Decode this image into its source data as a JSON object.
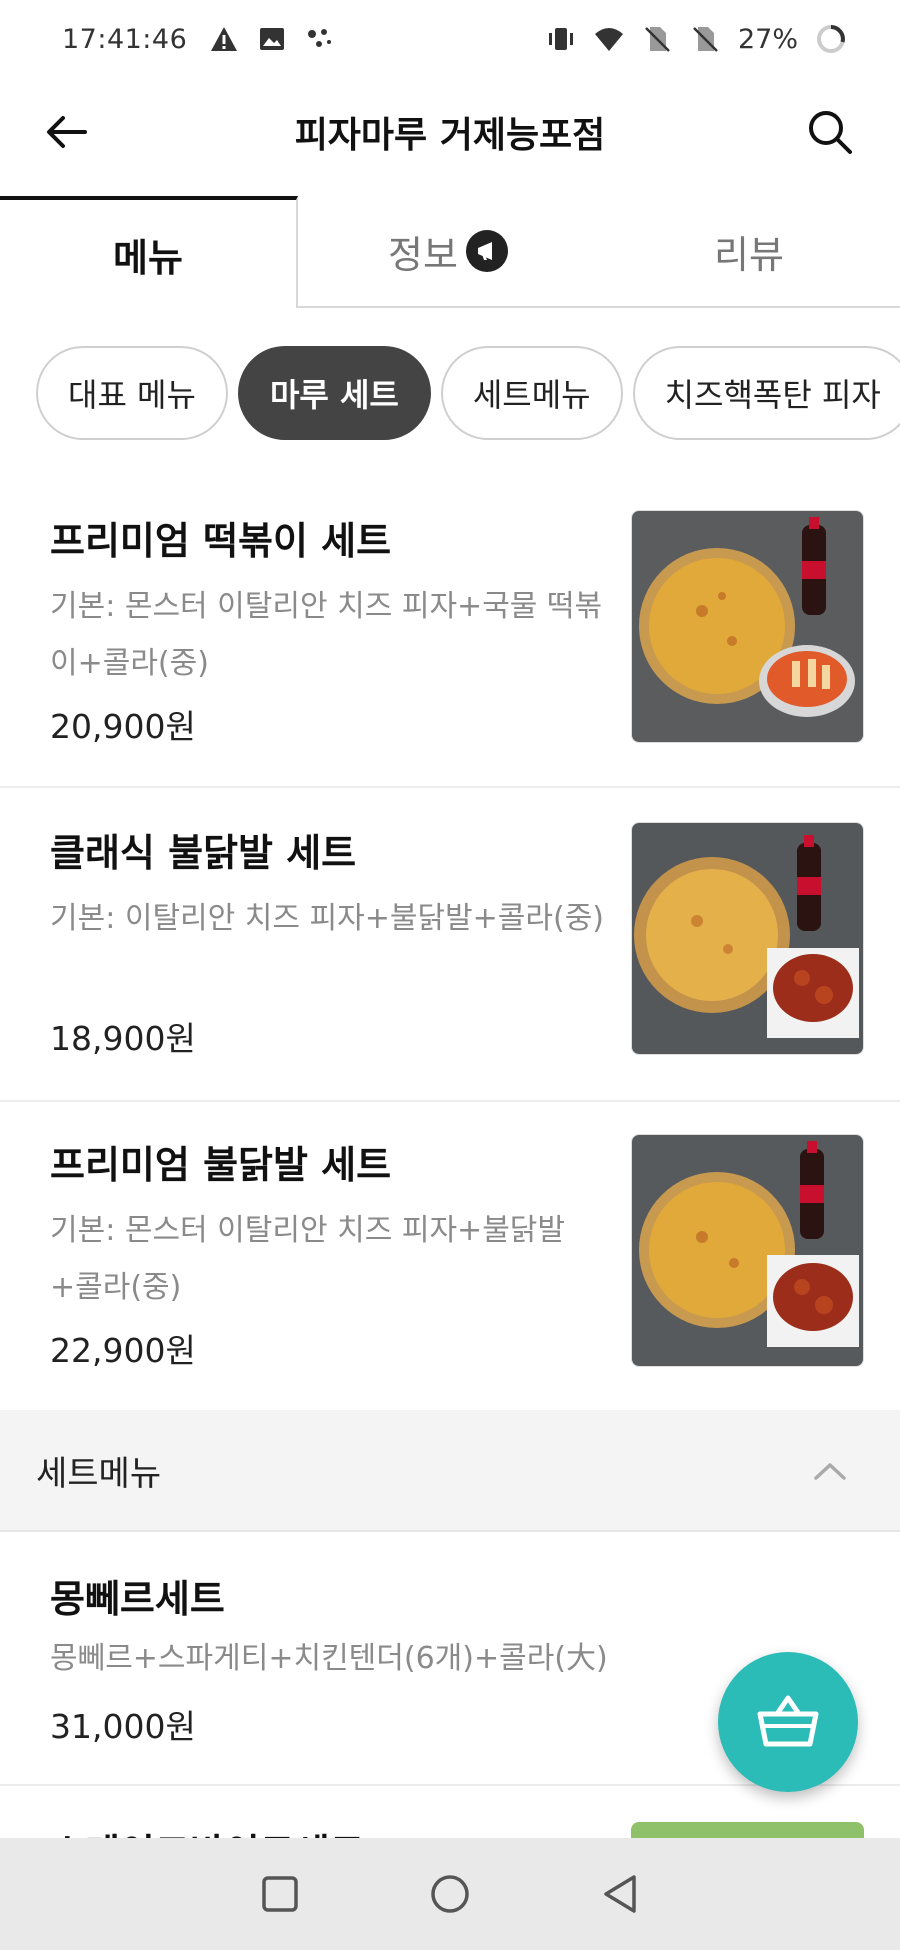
{
  "status_bar": {
    "time": "17:41:46",
    "battery": "27%"
  },
  "header": {
    "title": "피자마루 거제능포점"
  },
  "tabs": [
    {
      "label": "메뉴",
      "active": true
    },
    {
      "label": "정보",
      "active": false
    },
    {
      "label": "리뷰",
      "active": false
    }
  ],
  "chips": [
    {
      "label": "대표 메뉴",
      "active": false
    },
    {
      "label": "마루 세트",
      "active": true
    },
    {
      "label": "세트메뉴",
      "active": false
    },
    {
      "label": "치즈핵폭탄 피자",
      "active": false
    }
  ],
  "menu_items": [
    {
      "name": "프리미엄 떡볶이 세트",
      "desc": "기본: 몬스터 이탈리안 치즈 피자+국물 떡볶이+콜라(중)",
      "price": "20,900원"
    },
    {
      "name": "클래식 불닭발 세트",
      "desc": "기본: 이탈리안 치즈 피자+불닭발+콜라(중)",
      "price": "18,900원"
    },
    {
      "name": "프리미엄 불닭발 세트",
      "desc": "기본: 몬스터 이탈리안 치즈 피자+불닭발+콜라(중)",
      "price": "22,900원"
    }
  ],
  "section": {
    "title": "세트메뉴"
  },
  "set_items": [
    {
      "name": "몽뻬르세트",
      "desc": "몽뻬르+스파게티+치킨텐더(6개)+콜라(大)",
      "price": "31,000원"
    },
    {
      "name": "스테이크바이트세트"
    }
  ],
  "colors": {
    "accent": "#2cbcb8",
    "chip_active": "#444444",
    "text_muted": "#8a8a8a"
  },
  "icons": [
    "warning-icon",
    "image-icon",
    "dots-icon",
    "vibrate-icon",
    "wifi-icon",
    "no-sim-icon",
    "battery-icon",
    "back-arrow-icon",
    "search-icon",
    "megaphone-icon",
    "chevron-up-icon",
    "basket-icon",
    "recents-icon",
    "home-icon",
    "back-icon"
  ]
}
